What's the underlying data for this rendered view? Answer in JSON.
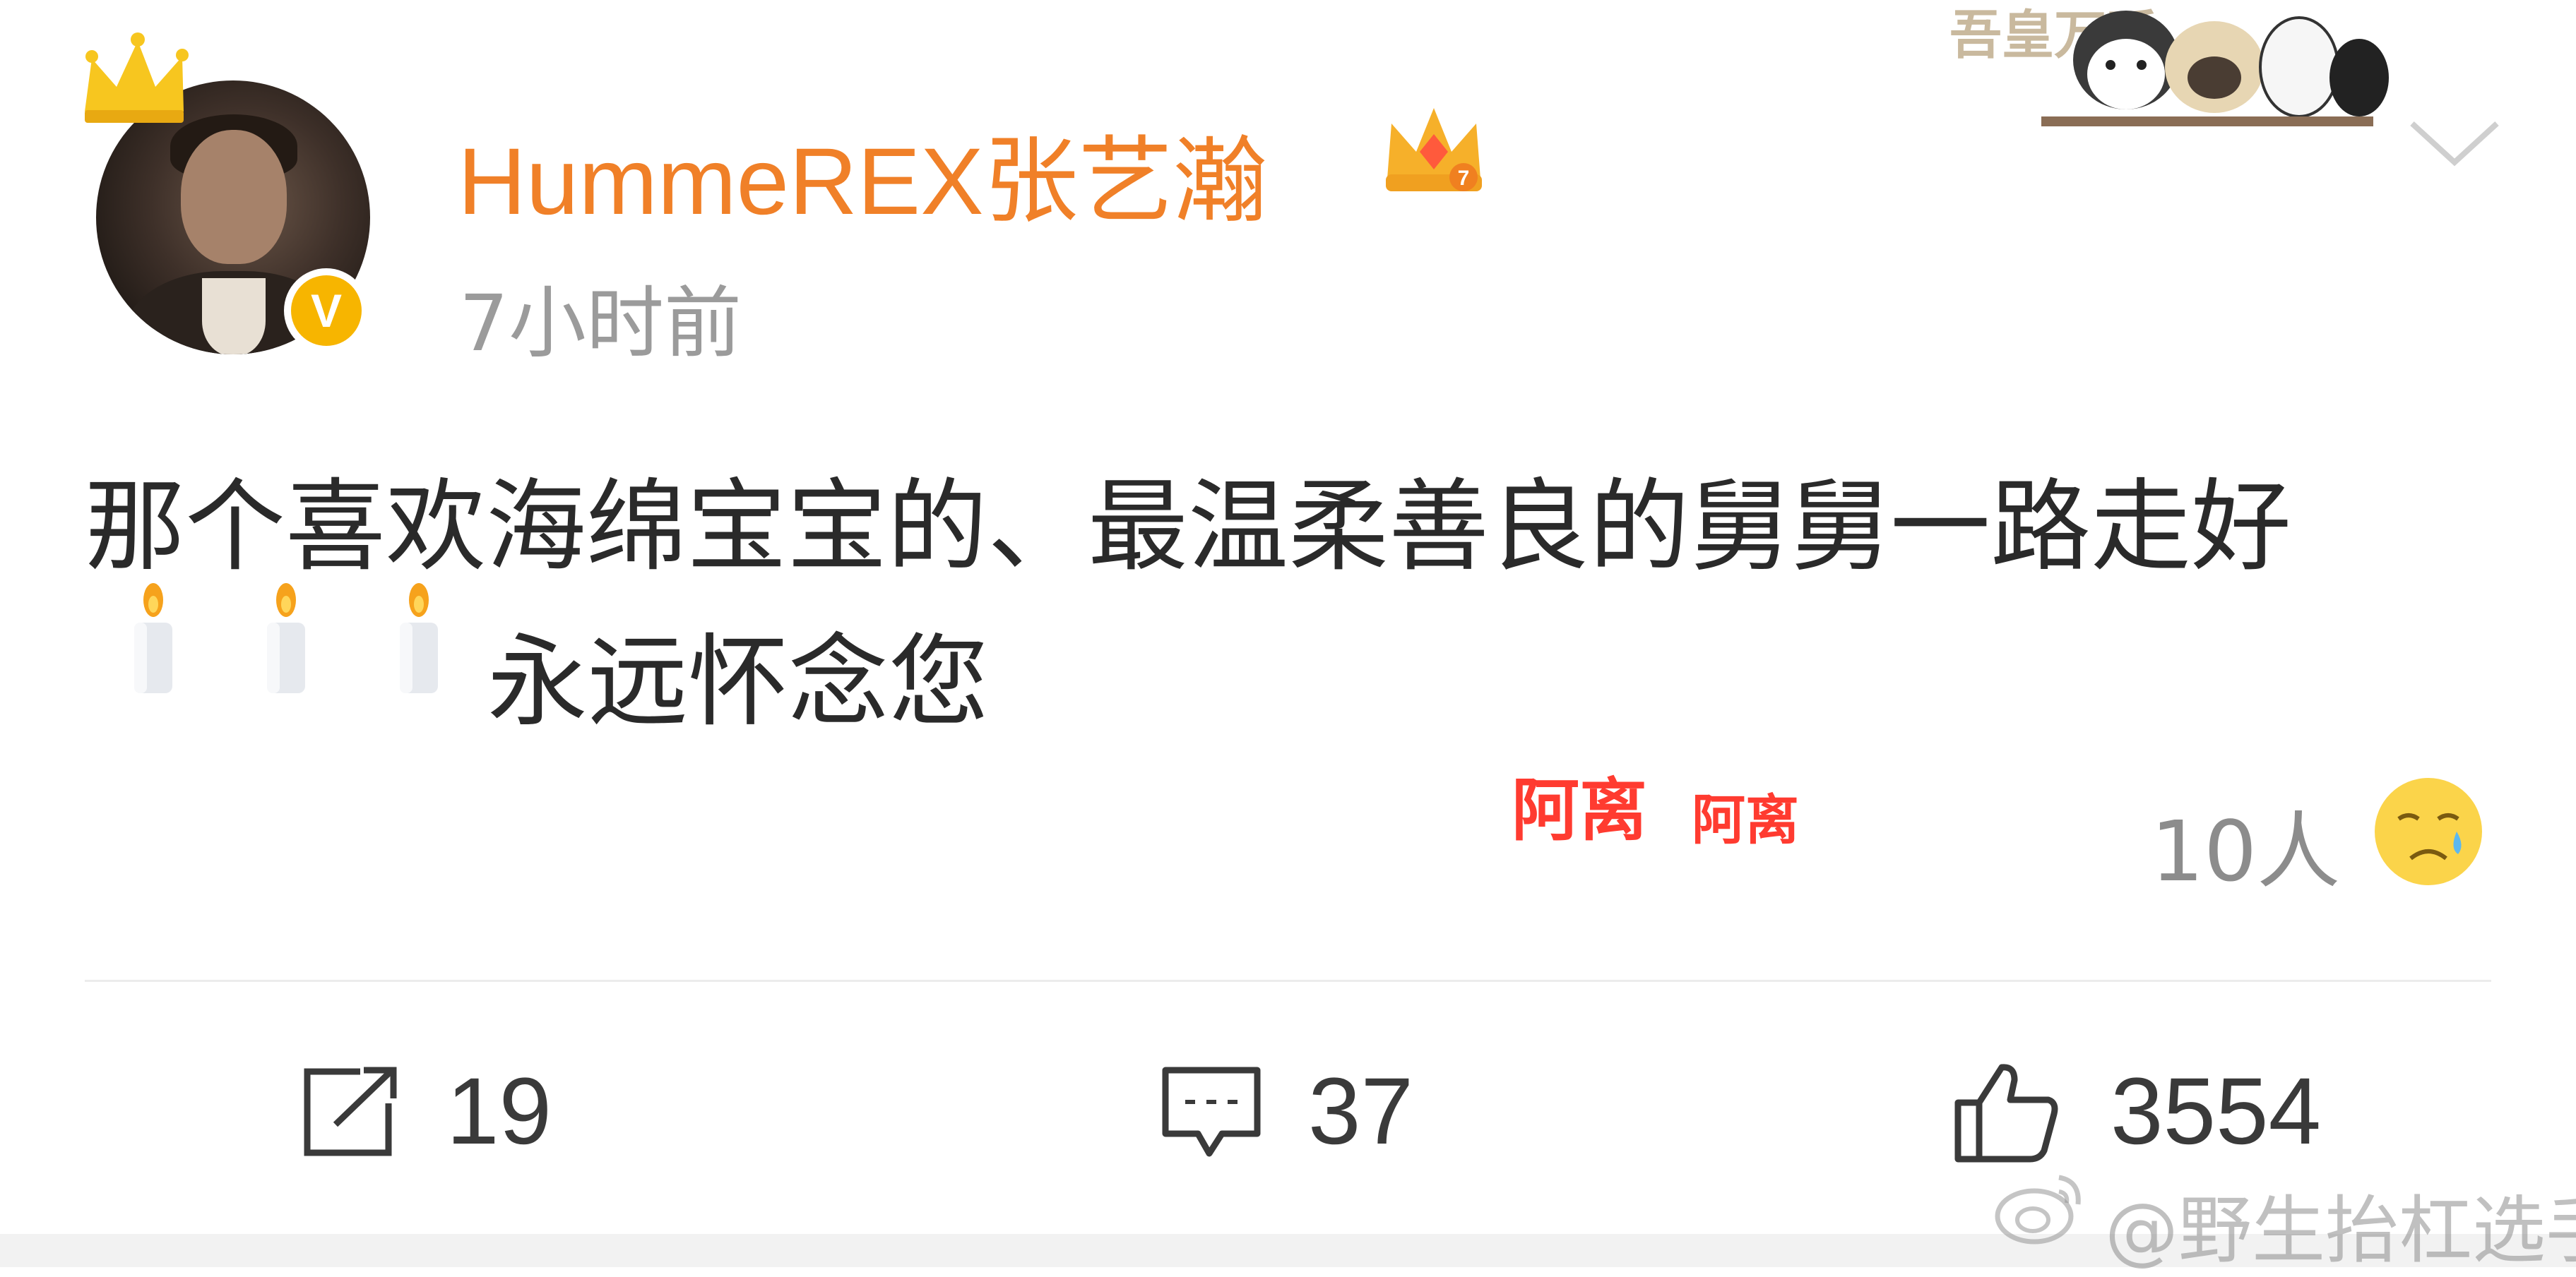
{
  "post": {
    "author": "HummeREX张艺瀚",
    "timestamp": "7小时前",
    "text_line_1": "那个喜欢海绵宝宝的、最温柔善良的舅舅一路走好",
    "text_line_2": "永远怀念您",
    "emoji_candles": [
      "candle-icon",
      "candle-icon",
      "candle-icon"
    ],
    "reaction": {
      "count_label": "10人",
      "emoji": "tears-emoji-icon"
    },
    "actions": {
      "repost": {
        "icon": "repost-icon",
        "count": "19"
      },
      "comment": {
        "icon": "comment-icon",
        "count": "37"
      },
      "like": {
        "icon": "thumbs-up-icon",
        "count": "3554"
      }
    }
  },
  "overlay": {
    "tag_large": "阿离",
    "tag_small": "阿离",
    "credit": "@野生抬杠选手",
    "sticker_text": "吾皇万睡"
  },
  "colors": {
    "username": "#f08028",
    "timestamp": "#9b9b9b",
    "body_text": "#2a2a2a",
    "verified_badge": "#f7b500",
    "overlay_tag": "#ff3b30"
  }
}
